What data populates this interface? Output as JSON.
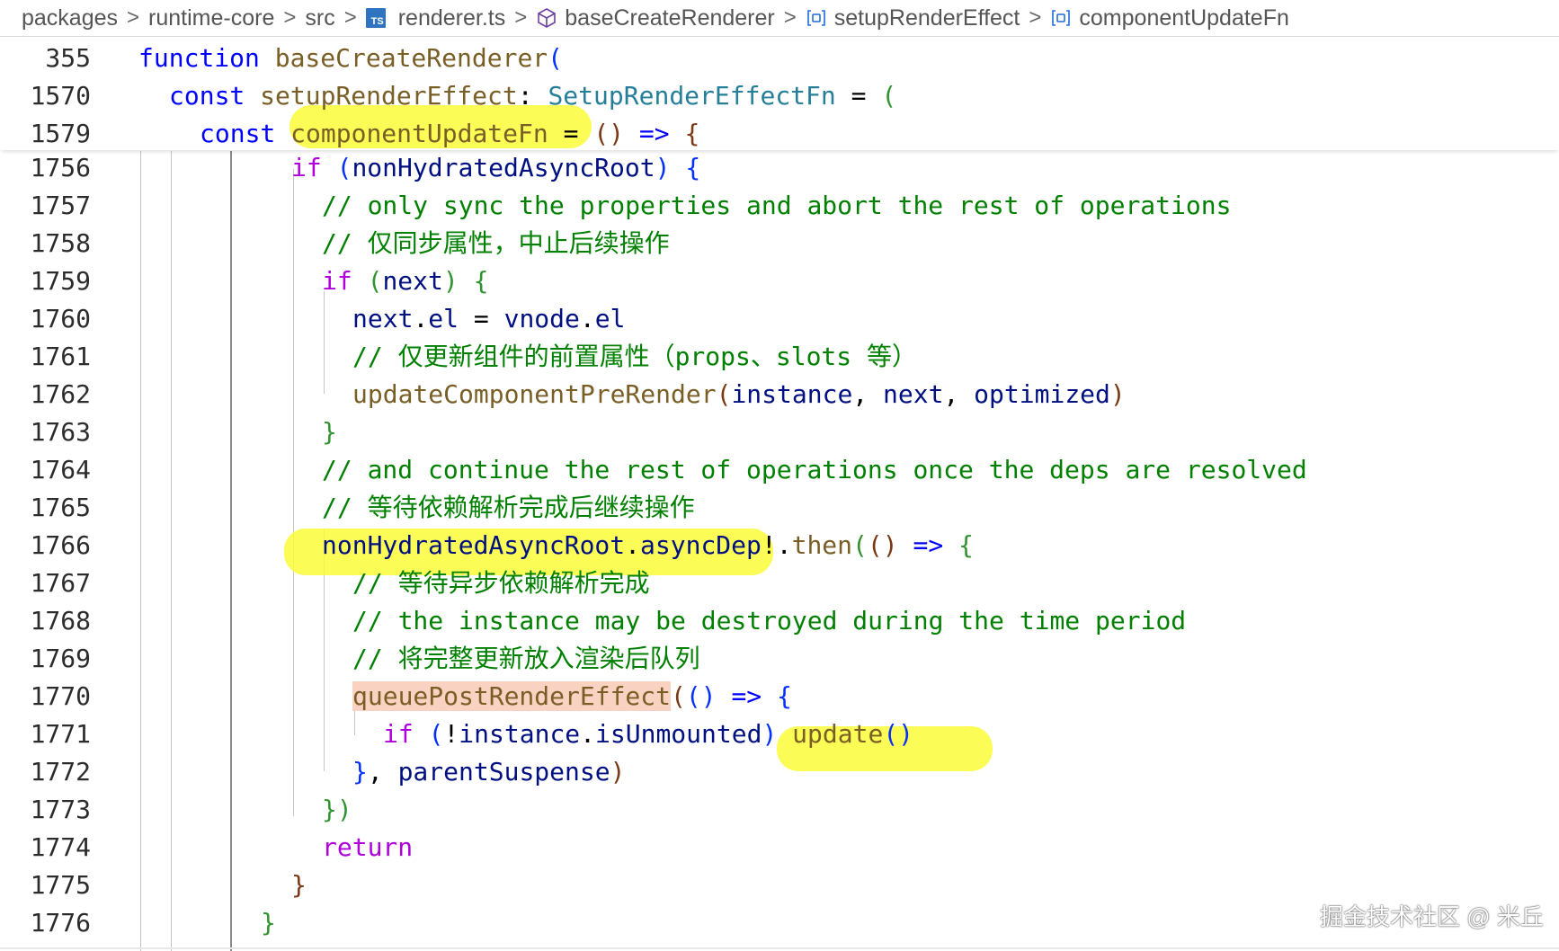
{
  "breadcrumb": {
    "items": [
      {
        "label": "packages",
        "icon": null
      },
      {
        "label": "runtime-core",
        "icon": null
      },
      {
        "label": "src",
        "icon": null
      },
      {
        "label": "renderer.ts",
        "icon": "typescript-file-icon",
        "icon_text": "TS"
      },
      {
        "label": "baseCreateRenderer",
        "icon": "cube-icon"
      },
      {
        "label": "setupRenderEffect",
        "icon": "variable-icon"
      },
      {
        "label": "componentUpdateFn",
        "icon": "variable-icon"
      }
    ]
  },
  "sticky_lines": [
    {
      "num": "355",
      "tokens": [
        [
          "kw",
          "function"
        ],
        [
          "pl",
          " "
        ],
        [
          "fn",
          "baseCreateRenderer"
        ],
        [
          "b1",
          "("
        ]
      ]
    },
    {
      "num": "1570",
      "tokens": [
        [
          "kw",
          "const"
        ],
        [
          "pl",
          " "
        ],
        [
          "fn",
          "setupRenderEffect"
        ],
        [
          "pl",
          ": "
        ],
        [
          "ty",
          "SetupRenderEffectFn"
        ],
        [
          "pl",
          " = "
        ],
        [
          "b2",
          "("
        ]
      ]
    },
    {
      "num": "1579",
      "tokens": [
        [
          "kw",
          "const"
        ],
        [
          "pl",
          " "
        ],
        [
          "fn",
          "componentUpdateFn"
        ],
        [
          "pl",
          " = "
        ],
        [
          "b3",
          "()"
        ],
        [
          "pl",
          " "
        ],
        [
          "kw",
          "=>"
        ],
        [
          "pl",
          " "
        ],
        [
          "b3",
          "{"
        ]
      ]
    }
  ],
  "code_lines": [
    {
      "num": "1756",
      "tokens": [
        [
          "ctrl",
          "if"
        ],
        [
          "pl",
          " "
        ],
        [
          "b1",
          "("
        ],
        [
          "var",
          "nonHydratedAsyncRoot"
        ],
        [
          "b1",
          ")"
        ],
        [
          "pl",
          " "
        ],
        [
          "b1",
          "{"
        ]
      ]
    },
    {
      "num": "1757",
      "tokens": [
        [
          "cm",
          "// only sync the properties and abort the rest of operations"
        ]
      ]
    },
    {
      "num": "1758",
      "tokens": [
        [
          "cm",
          "// 仅同步属性，中止后续操作"
        ]
      ]
    },
    {
      "num": "1759",
      "tokens": [
        [
          "ctrl",
          "if"
        ],
        [
          "pl",
          " "
        ],
        [
          "b2",
          "("
        ],
        [
          "var",
          "next"
        ],
        [
          "b2",
          ")"
        ],
        [
          "pl",
          " "
        ],
        [
          "b2",
          "{"
        ]
      ]
    },
    {
      "num": "1760",
      "tokens": [
        [
          "var",
          "next"
        ],
        [
          "pl",
          "."
        ],
        [
          "var",
          "el"
        ],
        [
          "pl",
          " = "
        ],
        [
          "var",
          "vnode"
        ],
        [
          "pl",
          "."
        ],
        [
          "var",
          "el"
        ]
      ]
    },
    {
      "num": "1761",
      "tokens": [
        [
          "cm",
          "// 仅更新组件的前置属性（props、slots 等）"
        ]
      ]
    },
    {
      "num": "1762",
      "tokens": [
        [
          "fn",
          "updateComponentPreRender"
        ],
        [
          "b3",
          "("
        ],
        [
          "var",
          "instance"
        ],
        [
          "pl",
          ", "
        ],
        [
          "var",
          "next"
        ],
        [
          "pl",
          ", "
        ],
        [
          "var",
          "optimized"
        ],
        [
          "b3",
          ")"
        ]
      ]
    },
    {
      "num": "1763",
      "tokens": [
        [
          "b2",
          "}"
        ]
      ]
    },
    {
      "num": "1764",
      "tokens": [
        [
          "cm",
          "// and continue the rest of operations once the deps are resolved"
        ]
      ]
    },
    {
      "num": "1765",
      "tokens": [
        [
          "cm",
          "// 等待依赖解析完成后继续操作"
        ]
      ]
    },
    {
      "num": "1766",
      "tokens": [
        [
          "var",
          "nonHydratedAsyncRoot"
        ],
        [
          "pl",
          "."
        ],
        [
          "var",
          "asyncDep"
        ],
        [
          "pl",
          "!."
        ],
        [
          "fn",
          "then"
        ],
        [
          "b2",
          "("
        ],
        [
          "b3",
          "()"
        ],
        [
          "pl",
          " "
        ],
        [
          "kw",
          "=>"
        ],
        [
          "pl",
          " "
        ],
        [
          "b2",
          "{"
        ]
      ]
    },
    {
      "num": "1767",
      "tokens": [
        [
          "cm",
          "// 等待异步依赖解析完成"
        ]
      ]
    },
    {
      "num": "1768",
      "tokens": [
        [
          "cm",
          "// the instance may be destroyed during the time period"
        ]
      ]
    },
    {
      "num": "1769",
      "tokens": [
        [
          "cm",
          "// 将完整更新放入渲染后队列"
        ]
      ]
    },
    {
      "num": "1770",
      "tokens": [
        [
          "fnred",
          "queuePostRenderEffect"
        ],
        [
          "b3",
          "("
        ],
        [
          "b1",
          "()"
        ],
        [
          "pl",
          " "
        ],
        [
          "kw",
          "=>"
        ],
        [
          "pl",
          " "
        ],
        [
          "b1",
          "{"
        ]
      ]
    },
    {
      "num": "1771",
      "tokens": [
        [
          "ctrl",
          "if"
        ],
        [
          "pl",
          " "
        ],
        [
          "b1",
          "("
        ],
        [
          "pl",
          "!"
        ],
        [
          "var",
          "instance"
        ],
        [
          "pl",
          "."
        ],
        [
          "var",
          "isUnmounted"
        ],
        [
          "b1",
          ")"
        ],
        [
          "pl",
          " "
        ],
        [
          "fn",
          "update"
        ],
        [
          "b1",
          "()"
        ]
      ]
    },
    {
      "num": "1772",
      "tokens": [
        [
          "b1",
          "}"
        ],
        [
          "pl",
          ", "
        ],
        [
          "var",
          "parentSuspense"
        ],
        [
          "b3",
          ")"
        ]
      ]
    },
    {
      "num": "1773",
      "tokens": [
        [
          "b2",
          "})"
        ]
      ]
    },
    {
      "num": "1774",
      "tokens": [
        [
          "ctrl",
          "return"
        ]
      ]
    },
    {
      "num": "1775",
      "tokens": [
        [
          "b3",
          "}"
        ]
      ]
    },
    {
      "num": "1776",
      "tokens": [
        [
          "b2",
          "}"
        ]
      ]
    }
  ],
  "watermark": "掘金技术社区 @ 米丘",
  "colors": {
    "keyword": "#0000ff",
    "control": "#af00db",
    "function": "#795e26",
    "type": "#267f99",
    "variable": "#001080",
    "comment": "#008000",
    "highlight": "#fbfb3a",
    "highlight_red": "#f9d2c2"
  }
}
